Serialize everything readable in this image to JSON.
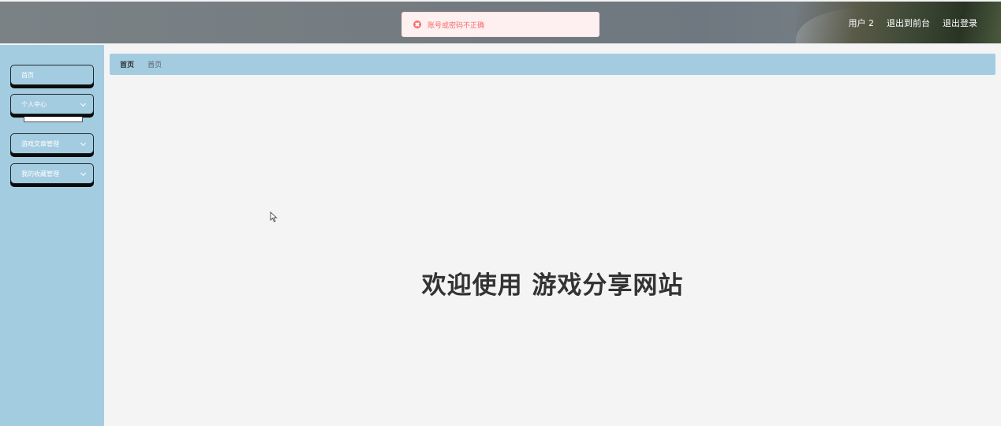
{
  "header": {
    "username": "用户 2",
    "to_frontend": "退出到前台",
    "logout": "退出登录"
  },
  "toast": {
    "message": "账号或密码不正确",
    "icon": "error-circle-icon",
    "color": "#f56c6c"
  },
  "sidebar": {
    "items": [
      {
        "label": "首页",
        "has_submenu": false
      },
      {
        "label": "个人中心",
        "has_submenu": true
      },
      {
        "label": "游戏文章管理",
        "has_submenu": true
      },
      {
        "label": "我的收藏管理",
        "has_submenu": true
      }
    ]
  },
  "breadcrumb": {
    "home": "首页",
    "separator": "/",
    "current": "首页"
  },
  "main": {
    "welcome": "欢迎使用 游戏分享网站"
  },
  "colors": {
    "sidebar_bg": "#a4cce0",
    "page_bg": "#f4f4f4",
    "error": "#f56c6c"
  }
}
